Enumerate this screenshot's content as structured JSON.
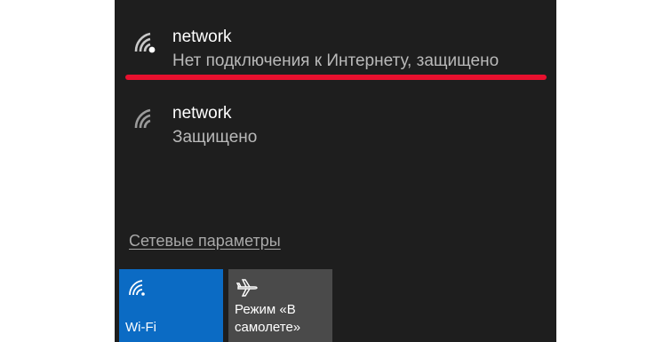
{
  "networks": [
    {
      "name": "network",
      "status": "Нет подключения к Интернету, защищено",
      "icon": "wifi-signal-icon",
      "highlighted": true,
      "highlight_color": "#e8102e"
    },
    {
      "name": "network",
      "status": "Защищено",
      "icon": "wifi-signal-icon",
      "highlighted": false
    }
  ],
  "settings_link": "Сетевые параметры",
  "quick_actions": [
    {
      "label": "Wi-Fi",
      "icon": "wifi-icon",
      "active": true,
      "color": "#0b6bc4"
    },
    {
      "label": "Режим «В самолете»",
      "icon": "airplane-icon",
      "active": false,
      "color": "#4a4a4a"
    }
  ],
  "colors": {
    "panel_background": "#1e1e1e",
    "primary_text": "#ffffff",
    "secondary_text": "#b9b9b9"
  }
}
